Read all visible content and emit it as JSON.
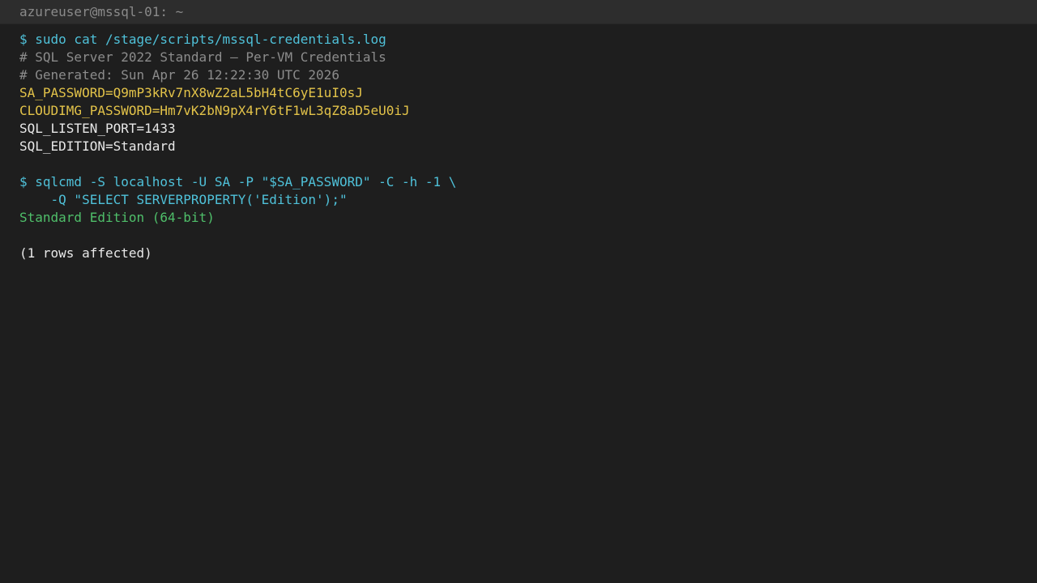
{
  "window": {
    "title": "azureuser@mssql-01: ~"
  },
  "terminal": {
    "lines": [
      {
        "text": "$ sudo cat /stage/scripts/mssql-credentials.log",
        "kind": "command"
      },
      {
        "text": "# SQL Server 2022 Standard — Per-VM Credentials",
        "kind": "comment"
      },
      {
        "text": "# Generated: Sun Apr 26 12:22:30 UTC 2026",
        "kind": "comment"
      },
      {
        "text": "SA_PASSWORD=Q9mP3kRv7nX8wZ2aL5bH4tC6yE1uI0sJ",
        "kind": "secret"
      },
      {
        "text": "CLOUDIMG_PASSWORD=Hm7vK2bN9pX4rY6tF1wL3qZ8aD5eU0iJ",
        "kind": "secret"
      },
      {
        "text": "SQL_LISTEN_PORT=1433",
        "kind": "plain"
      },
      {
        "text": "SQL_EDITION=Standard",
        "kind": "plain"
      },
      {
        "text": "",
        "kind": "blank"
      },
      {
        "text": "$ sqlcmd -S localhost -U SA -P \"$SA_PASSWORD\" -C -h -1 \\",
        "kind": "command"
      },
      {
        "text": "    -Q \"SELECT SERVERPROPERTY('Edition');\"",
        "kind": "command"
      },
      {
        "text": "Standard Edition (64-bit)",
        "kind": "output"
      },
      {
        "text": "",
        "kind": "blank"
      },
      {
        "text": "(1 rows affected)",
        "kind": "plain"
      }
    ]
  },
  "colors": {
    "background": "#1e1e1e",
    "titlebar": "#2d2d2d",
    "command": "#4fc1d9",
    "comment": "#8c8c8c",
    "secret": "#e3c349",
    "plain": "#e8e8e8",
    "output": "#4fbf6a"
  }
}
